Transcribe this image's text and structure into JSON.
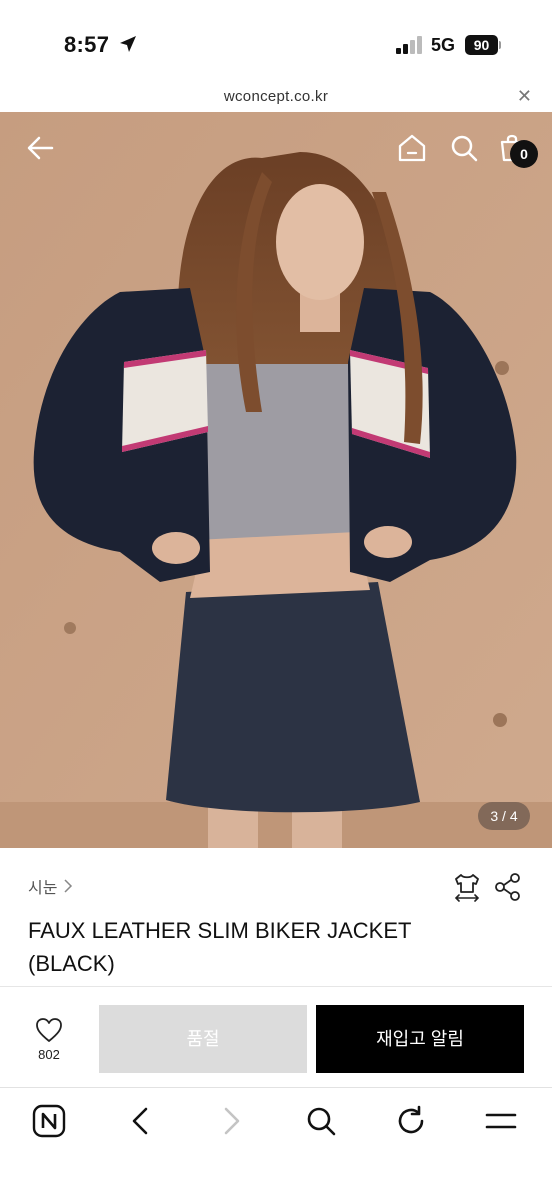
{
  "status_bar": {
    "time": "8:57",
    "network": "5G",
    "battery": "90"
  },
  "browser": {
    "url": "wconcept.co.kr"
  },
  "hero": {
    "counter": "3 / 4",
    "cart_count": "0"
  },
  "product": {
    "brand": "시눈",
    "name": "FAUX LEATHER SLIM BIKER JACKET (BLACK)"
  },
  "actions": {
    "like_count": "802",
    "soldout_label": "품절",
    "notify_label": "재입고 알림"
  },
  "icons": {
    "back": "arrow-left-icon",
    "home": "home-icon",
    "search": "search-icon",
    "cart": "shopping-bag-icon",
    "size": "size-guide-icon",
    "share": "share-icon",
    "like": "heart-icon",
    "naver": "naver-n-icon",
    "browser_back": "chevron-left-icon",
    "browser_forward": "chevron-right-icon",
    "browser_search": "search-icon",
    "reload": "reload-icon",
    "menu": "menu-icon"
  },
  "colors": {
    "accent": "#000000",
    "soldout_bg": "#dcdcdc",
    "backdrop": "#c9a184"
  }
}
